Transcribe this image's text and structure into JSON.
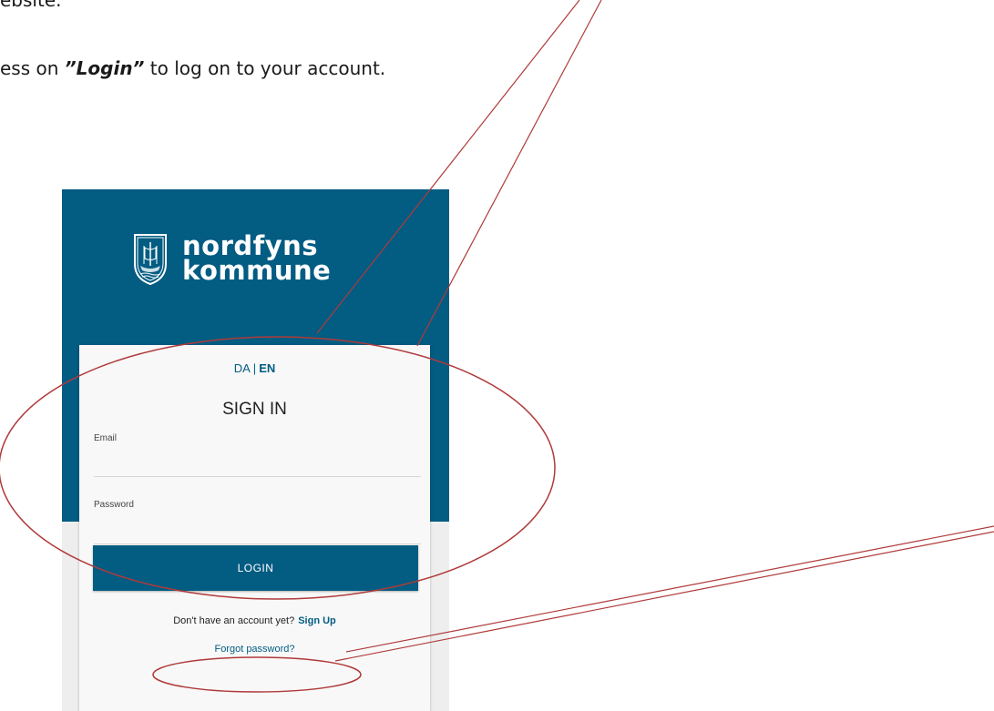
{
  "document": {
    "line1": "ebsite.",
    "line2_prefix": "ess on ",
    "line2_emphasis": "”Login”",
    "line2_suffix": " to log on to your account."
  },
  "login_page": {
    "brand": {
      "line1": "nordfyns",
      "line2": "kommune",
      "icon": "crest-icon"
    },
    "language": {
      "da": "DA",
      "separator": "|",
      "en": "EN",
      "active": "EN"
    },
    "title": "SIGN IN",
    "email": {
      "label": "Email",
      "value": ""
    },
    "password": {
      "label": "Password",
      "value": ""
    },
    "login_button": "LOGIN",
    "signup": {
      "prompt": "Don't have an account yet?",
      "link": "Sign Up"
    },
    "forgot_password": "Forgot password?"
  },
  "colors": {
    "brand_blue": "#035c82",
    "annotation_red": "#b03a3a",
    "card_bg": "#f8f8f8",
    "page_bg": "#eeeeee"
  }
}
